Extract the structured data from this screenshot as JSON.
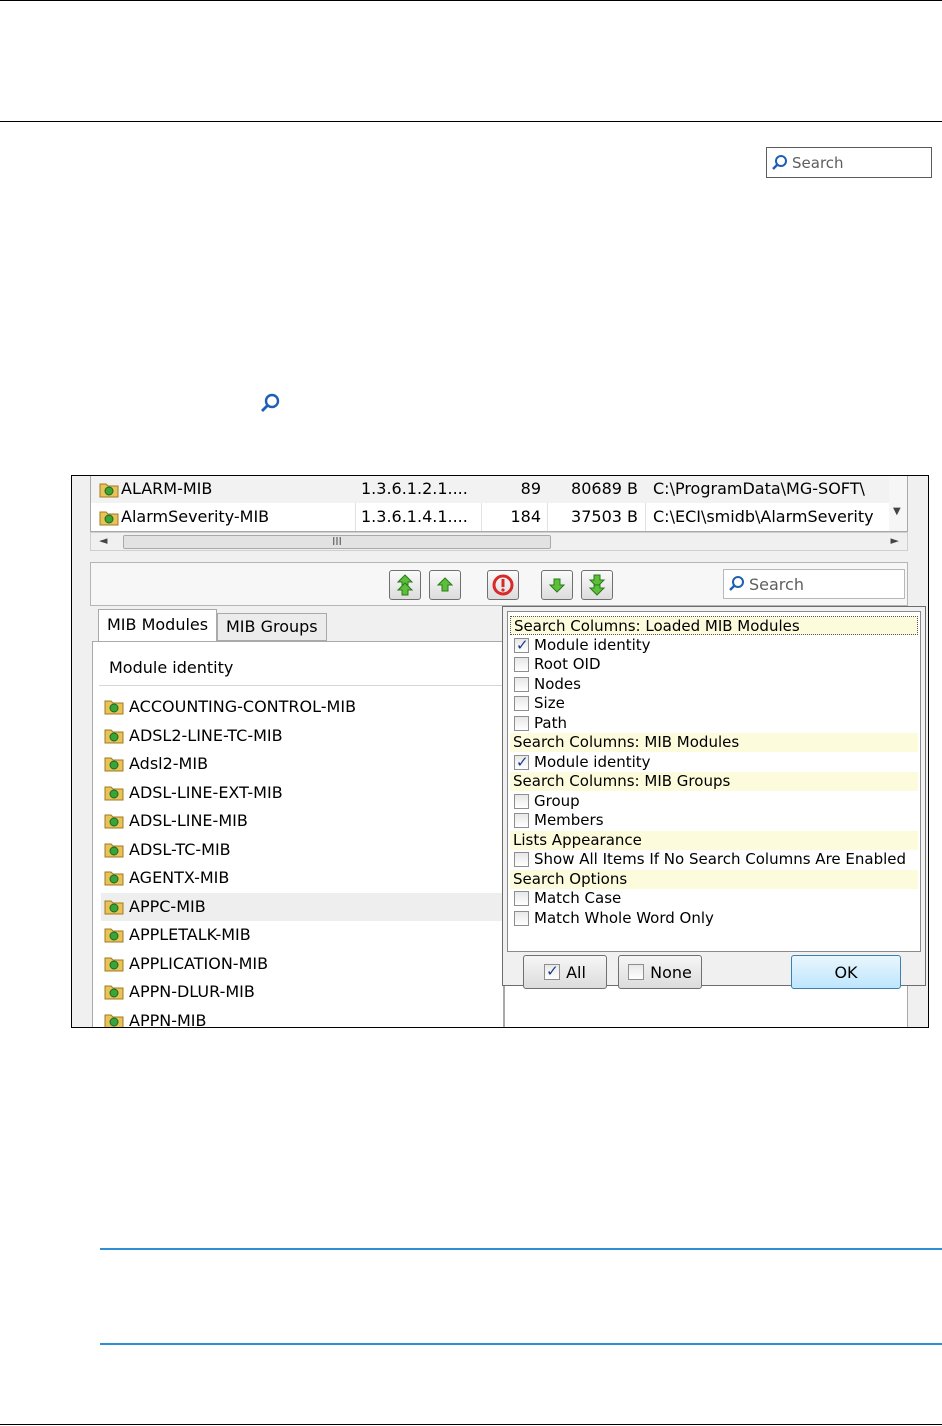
{
  "top_search": {
    "placeholder": "Search"
  },
  "loaded_modules": {
    "rows": [
      {
        "name": "ALARM-MIB",
        "oid": "1.3.6.1.2.1....",
        "nodes": "89",
        "size": "80689 B",
        "path": "C:\\ProgramData\\MG-SOFT\\"
      },
      {
        "name": "AlarmSeverity-MIB",
        "oid": "1.3.6.1.4.1....",
        "nodes": "184",
        "size": "37503 B",
        "path": "C:\\ECI\\smidb\\AlarmSeverity"
      }
    ]
  },
  "scrollbar": {
    "grip": "III",
    "left_arrow": "◄",
    "right_arrow": "►"
  },
  "toolbar": {
    "search_placeholder": "Search"
  },
  "tabs": [
    {
      "label": "MIB Modules"
    },
    {
      "label": "MIB Groups"
    }
  ],
  "module_list": {
    "header": "Module identity",
    "items": [
      "ACCOUNTING-CONTROL-MIB",
      "ADSL2-LINE-TC-MIB",
      "Adsl2-MIB",
      "ADSL-LINE-EXT-MIB",
      "ADSL-LINE-MIB",
      "ADSL-TC-MIB",
      "AGENTX-MIB",
      "APPC-MIB",
      "APPLETALK-MIB",
      "APPLICATION-MIB",
      "APPN-DLUR-MIB",
      "APPN-MIB"
    ],
    "selected_index": 7
  },
  "popup": {
    "sections": [
      {
        "title": "Search Columns: Loaded MIB Modules",
        "options": [
          {
            "label": "Module identity",
            "checked": true
          },
          {
            "label": "Root OID",
            "checked": false
          },
          {
            "label": "Nodes",
            "checked": false
          },
          {
            "label": "Size",
            "checked": false
          },
          {
            "label": "Path",
            "checked": false
          }
        ]
      },
      {
        "title": "Search Columns: MIB Modules",
        "options": [
          {
            "label": "Module identity",
            "checked": true
          }
        ]
      },
      {
        "title": "Search Columns: MIB Groups",
        "options": [
          {
            "label": "Group",
            "checked": false
          },
          {
            "label": "Members",
            "checked": false
          }
        ]
      },
      {
        "title": "Lists Appearance",
        "options": [
          {
            "label": "Show All Items If No Search Columns Are Enabled",
            "checked": false
          }
        ]
      },
      {
        "title": "Search Options",
        "options": [
          {
            "label": "Match Case",
            "checked": false
          },
          {
            "label": "Match Whole Word Only",
            "checked": false
          }
        ]
      }
    ],
    "buttons": {
      "all": "All",
      "none": "None",
      "ok": "OK"
    }
  },
  "colors": {
    "note_border": "#2f8fd6",
    "section_bg": "#fcfbdc",
    "ok_button": "#bee6fd"
  },
  "icons": [
    "search-icon",
    "folder-module-icon",
    "move-top-icon",
    "move-up-icon",
    "unload-icon",
    "move-down-icon",
    "move-bottom-icon"
  ]
}
